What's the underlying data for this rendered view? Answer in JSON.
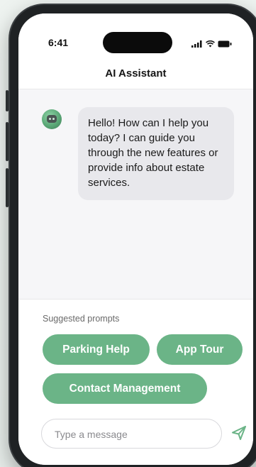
{
  "status_bar": {
    "time": "6:41",
    "icons": [
      "signal-icon",
      "wifi-icon",
      "battery-icon"
    ]
  },
  "header": {
    "title": "AI Assistant"
  },
  "chat": {
    "messages": [
      {
        "sender": "assistant",
        "avatar_icon": "robot-icon",
        "text": "Hello! How can I help you today? I can guide you through the new features or provide info about estate services."
      }
    ]
  },
  "suggestions": {
    "label": "Suggested prompts",
    "chips": [
      {
        "label": "Parking Help"
      },
      {
        "label": "App Tour"
      },
      {
        "label": "Contact Management"
      }
    ]
  },
  "composer": {
    "placeholder": "Type a message",
    "send_icon": "send-icon"
  },
  "colors": {
    "accent": "#6bb487",
    "bubble": "#e8e8ec",
    "frame": "#1f2224"
  }
}
